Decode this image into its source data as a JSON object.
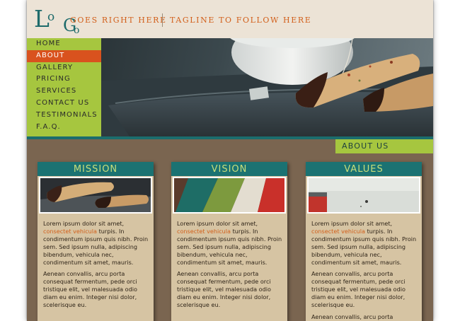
{
  "header": {
    "logo": {
      "letters": [
        "L",
        "o",
        "G",
        "o"
      ],
      "text": "LoGo"
    },
    "slogan": "GOES RIGHT HERE",
    "tagline": "TAGLINE TO FOLLOW HERE"
  },
  "nav": {
    "items": [
      {
        "label": "HOME",
        "active": false
      },
      {
        "label": "ABOUT",
        "active": true
      },
      {
        "label": "GALLERY",
        "active": false
      },
      {
        "label": "PRICING",
        "active": false
      },
      {
        "label": "SERVICES",
        "active": false
      },
      {
        "label": "CONTACT US",
        "active": false
      },
      {
        "label": "TESTIMONIALS",
        "active": false
      },
      {
        "label": "F.A.Q.",
        "active": false
      }
    ]
  },
  "section_tab": "ABOUT US",
  "cards": [
    {
      "title": "MISSION",
      "p1_before": "Lorem ipsum dolor sit amet, ",
      "p1_link": "consectet vehicula",
      "p1_after": " turpis. In condimentum ipsum quis nibh. Proin sem. Sed ipsum nulla, adipiscing bibendum, vehicula nec, condimentum sit amet, mauris.",
      "p2": "Aenean convallis, arcu porta consequat fermentum, pede orci tristique elit, vel malesuada odio diam eu enim. Integer nisi dolor, scelerisque eu."
    },
    {
      "title": "VISION",
      "p1_before": "Lorem ipsum dolor sit amet, ",
      "p1_link": "consectet vehicula",
      "p1_after": " turpis. In condimentum ipsum quis nibh. Proin sem. Sed ipsum nulla, adipiscing bibendum, vehicula nec, condimentum sit amet, mauris.",
      "p2": "Aenean convallis, arcu porta consequat fermentum, pede orci tristique elit, vel malesuada odio diam eu enim. Integer nisi dolor, scelerisque eu."
    },
    {
      "title": "VALUES",
      "p1_before": "Lorem ipsum dolor sit amet, ",
      "p1_link": "consectet vehicula",
      "p1_after": " turpis. In condimentum ipsum quis nibh. Proin sem. Sed ipsum nulla, adipiscing bibendum, vehicula nec, condimentum sit amet, mauris.",
      "p2": "Aenean convallis, arcu porta consequat fermentum, pede orci tristique elit, vel malesuada odio diam eu enim. Integer nisi dolor, scelerisque eu.",
      "p3": "Aenean convallis, arcu porta consequat fermentum, pede orci"
    }
  ],
  "colors": {
    "accent_orange": "#d9521e",
    "nav_green": "#a6c63f",
    "teal": "#1b7272",
    "body_brown": "#7a6550",
    "card_tan": "#d6c4a3",
    "header_cream": "#ece3d6"
  }
}
